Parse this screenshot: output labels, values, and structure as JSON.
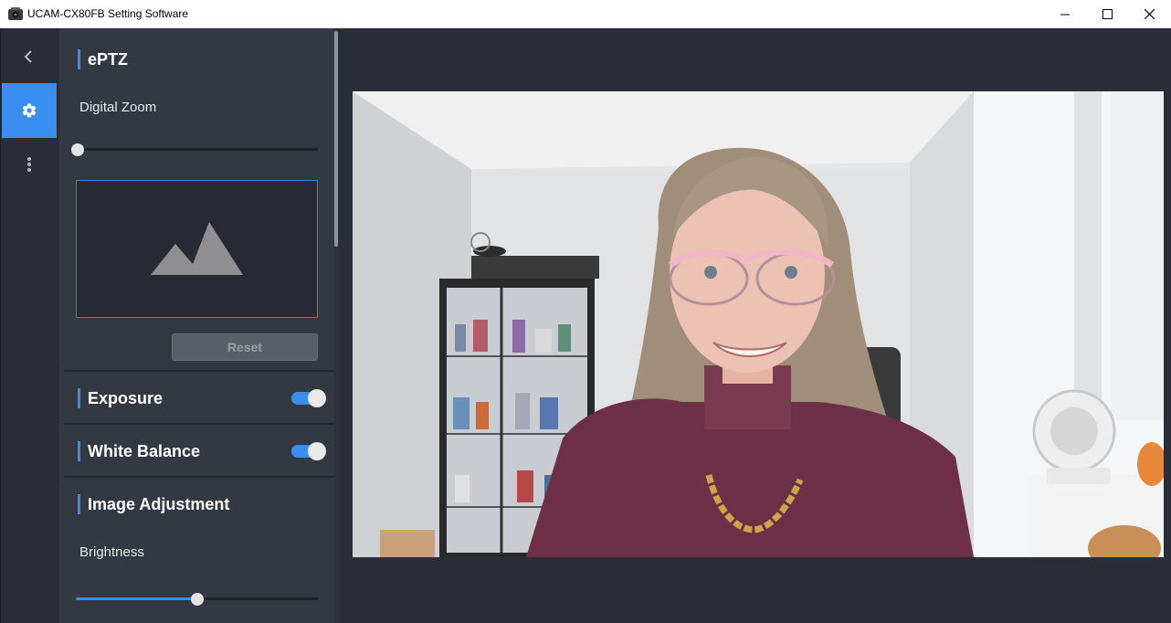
{
  "window": {
    "title": "UCAM-CX80FB Setting Software"
  },
  "icons": {
    "app": "camera-icon",
    "back": "chevron-left-icon",
    "settings": "gear-icon",
    "more": "vertical-dots-icon",
    "image_placeholder": "mountain-image-icon"
  },
  "colors": {
    "accent": "#3a8ef0",
    "panel": "#343843",
    "background": "#2b2e38"
  },
  "eptz": {
    "title": "ePTZ",
    "digital_zoom_label": "Digital Zoom",
    "digital_zoom_value": 0,
    "reset_label": "Reset"
  },
  "exposure": {
    "title": "Exposure",
    "enabled": true
  },
  "white_balance": {
    "title": "White Balance",
    "enabled": true
  },
  "image_adjustment": {
    "title": "Image Adjustment",
    "brightness_label": "Brightness",
    "brightness_value": 0.5
  }
}
